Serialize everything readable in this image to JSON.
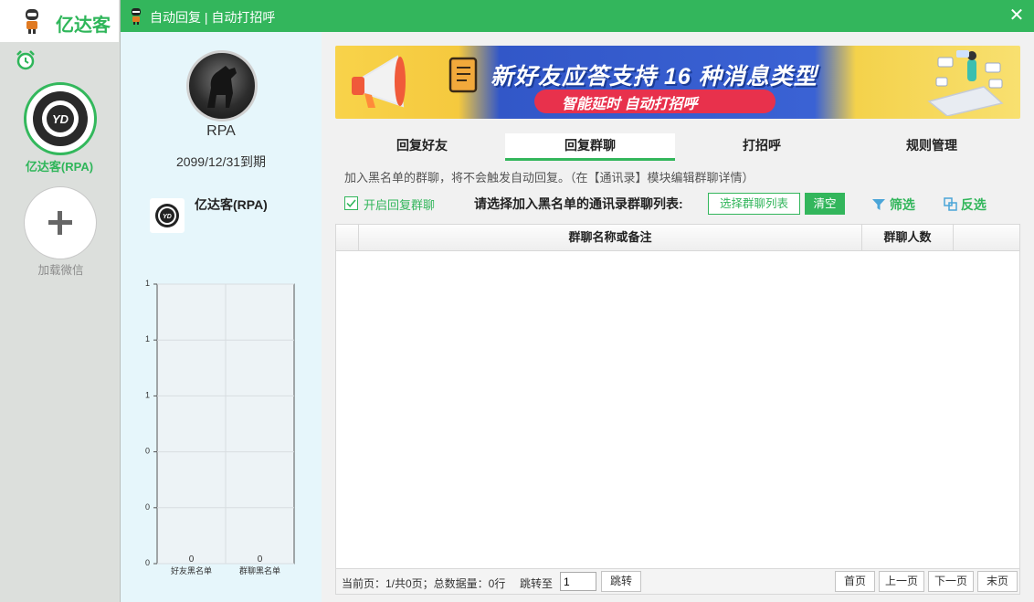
{
  "app": {
    "name": "亿达客",
    "logo_icon": "robot-icon",
    "alarm_icon": "alarm-clock-icon",
    "account_name": "亿达客(RPA)",
    "account_avatar_text": "YD",
    "add_label": "加载微信",
    "brand_color": "#33b65c"
  },
  "dialog": {
    "title": "自动回复 | 自动打招呼",
    "close_icon": "close-icon"
  },
  "profile": {
    "name": "RPA",
    "expiry": "2099/12/31到期",
    "bot_name": "亿达客(RPA)",
    "bot_avatar_text": "YD"
  },
  "chart_data": {
    "type": "bar",
    "categories": [
      "好友黑名单",
      "群聊黑名单"
    ],
    "values": [
      0,
      0
    ],
    "data_labels": [
      "0",
      "0"
    ],
    "y_tick_labels": [
      "0",
      "0",
      "0",
      "1",
      "1",
      "1"
    ],
    "grid": true
  },
  "banner": {
    "headline": "新好友应答支持 16 种消息类型",
    "subline": "智能延时  自动打招呼"
  },
  "tabs": [
    {
      "label": "回复好友",
      "active": false
    },
    {
      "label": "回复群聊",
      "active": true
    },
    {
      "label": "打招呼",
      "active": false
    },
    {
      "label": "规则管理",
      "active": false
    }
  ],
  "note": "加入黑名单的群聊，将不会触发自动回复。（在【通讯录】模块编辑群聊详情）",
  "toolbar": {
    "enable_label": "开启回复群聊",
    "enable_checked": true,
    "blacklist_title": "请选择加入黑名单的通讯录群聊列表:",
    "select_btn": "选择群聊列表",
    "clear_btn": "清空",
    "filter_btn": "筛选",
    "filter_icon": "funnel-icon",
    "invert_btn": "反选",
    "invert_icon": "invert-selection-icon"
  },
  "table": {
    "columns": [
      "",
      "群聊名称或备注",
      "群聊人数",
      ""
    ],
    "rows": []
  },
  "pager": {
    "info": "当前页：1/共0页；总数据量：0行",
    "jump_label": "跳转至",
    "jump_value": "1",
    "jump_btn": "跳转",
    "first": "首页",
    "prev": "上一页",
    "next": "下一页",
    "last": "末页"
  }
}
